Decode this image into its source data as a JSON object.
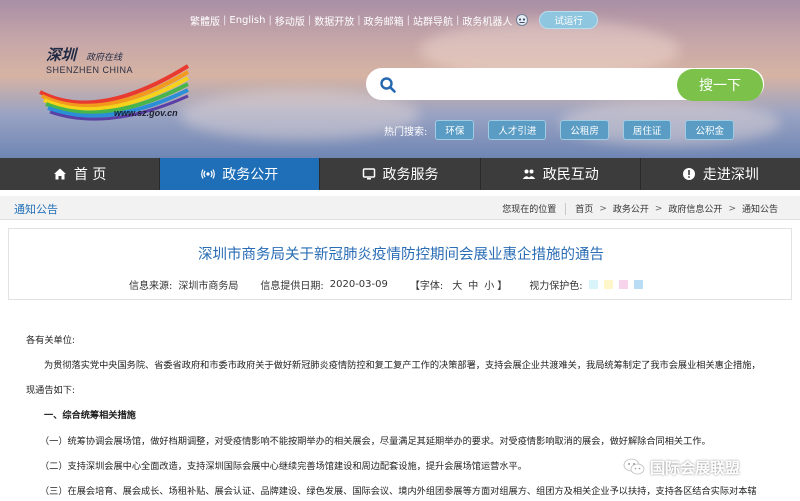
{
  "header": {
    "top_links": [
      "繁體版",
      "English",
      "移动版",
      "数据开放",
      "政务邮箱",
      "站群导航",
      "政务机器人"
    ],
    "trial_label": "试运行",
    "logo": {
      "cn_title": "深圳",
      "cn_sub": "政府在线",
      "en": "SHENZHEN CHINA",
      "url": "www.sz.gov.cn"
    },
    "search": {
      "placeholder": "",
      "button_label": "搜一下"
    },
    "hot_label": "热门搜索:",
    "hot_tags": [
      "环保",
      "人才引进",
      "公租房",
      "居住证",
      "公积金"
    ]
  },
  "nav": {
    "items": [
      {
        "label": "首 页",
        "icon": "home-icon"
      },
      {
        "label": "政务公开",
        "icon": "broadcast-icon"
      },
      {
        "label": "政务服务",
        "icon": "monitor-icon"
      },
      {
        "label": "政民互动",
        "icon": "people-icon"
      },
      {
        "label": "走进深圳",
        "icon": "location-icon"
      }
    ],
    "active_index": 1
  },
  "breadcrumb": {
    "section_title": "通知公告",
    "prefix": "您现在的位置",
    "items": [
      "首页",
      "政务公开",
      "政府信息公开",
      "通知公告"
    ]
  },
  "article": {
    "title": "深圳市商务局关于新冠肺炎疫情防控期间会展业惠企措施的通告",
    "source_label": "信息来源:",
    "source": "深圳市商务局",
    "date_label": "信息提供日期:",
    "date": "2020-03-09",
    "font_label": "【字体:",
    "font_sizes": [
      "大",
      "中",
      "小"
    ],
    "font_close": "】",
    "vision_label": "视力保护色:",
    "vision_colors": [
      "#d9f4fb",
      "#fff6c9",
      "#f7d3ec",
      "#b9ddf5"
    ],
    "paragraphs": [
      {
        "text": "各有关单位:",
        "bold": false
      },
      {
        "text": "为贯彻落实党中央国务院、省委省政府和市委市政府关于做好新冠肺炎疫情防控和复工复产工作的决策部署，支持会展企业共渡难关，我局统筹制定了我市会展业相关惠企措施，",
        "bold": false
      },
      {
        "text": "现通告如下:",
        "bold": false
      },
      {
        "text": "一、综合统筹相关措施",
        "bold": true
      },
      {
        "text": "（一）统筹协调会展场馆，做好档期调整，对受疫情影响不能按期举办的相关展会，尽量满足其延期举办的要求。对受疫情影响取消的展会，做好解除合同相关工作。",
        "bold": false
      },
      {
        "text": "（二）支持深圳会展中心全面改造，支持深圳国际会展中心继续完善场馆建设和周边配套设施，提升会展场馆运营水平。",
        "bold": false
      },
      {
        "text": "（三）在展会培育、展会成长、场租补贴、展会认证、品牌建设、绿色发展、国际会议、境内外组团参展等方面对组展方、组团方及相关企业予以扶持，支持各区结合实际对本辖",
        "bold": false
      }
    ]
  },
  "watermark": {
    "text": "国际会展联盟",
    "icon": "wechat-icon"
  }
}
